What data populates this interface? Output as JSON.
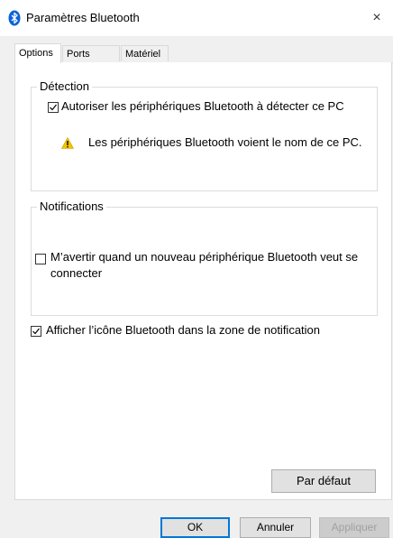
{
  "window": {
    "title": "Paramètres Bluetooth",
    "close_glyph": "×"
  },
  "tabs": [
    {
      "label": "Options",
      "active": true
    },
    {
      "label": "Ports COM",
      "active": false
    },
    {
      "label": "Matériel",
      "active": false
    }
  ],
  "detection": {
    "legend": "Détection",
    "allow_discovery": {
      "label": "Autoriser les périphériques Bluetooth à détecter ce PC",
      "checked": true
    },
    "warning_text": "Les périphériques Bluetooth voient le nom de ce PC.",
    "warning_icon": "warning-icon"
  },
  "notifications": {
    "legend": "Notifications",
    "alert_new_device": {
      "label": "M’avertir quand un nouveau périphérique Bluetooth veut se connecter",
      "line1": "M’avertir quand un nouveau périphérique Bluetooth veut se",
      "line2": "connecter",
      "checked": false
    }
  },
  "show_tray_icon": {
    "label": "Afficher l’icône Bluetooth dans la zone de notification",
    "checked": true
  },
  "buttons": {
    "defaults": "Par défaut",
    "ok": "OK",
    "cancel": "Annuler",
    "apply": "Appliquer"
  },
  "colors": {
    "bluetooth_blue": "#0a64d7",
    "warning_yellow": "#f5c400",
    "focus_blue": "#0078d7"
  }
}
